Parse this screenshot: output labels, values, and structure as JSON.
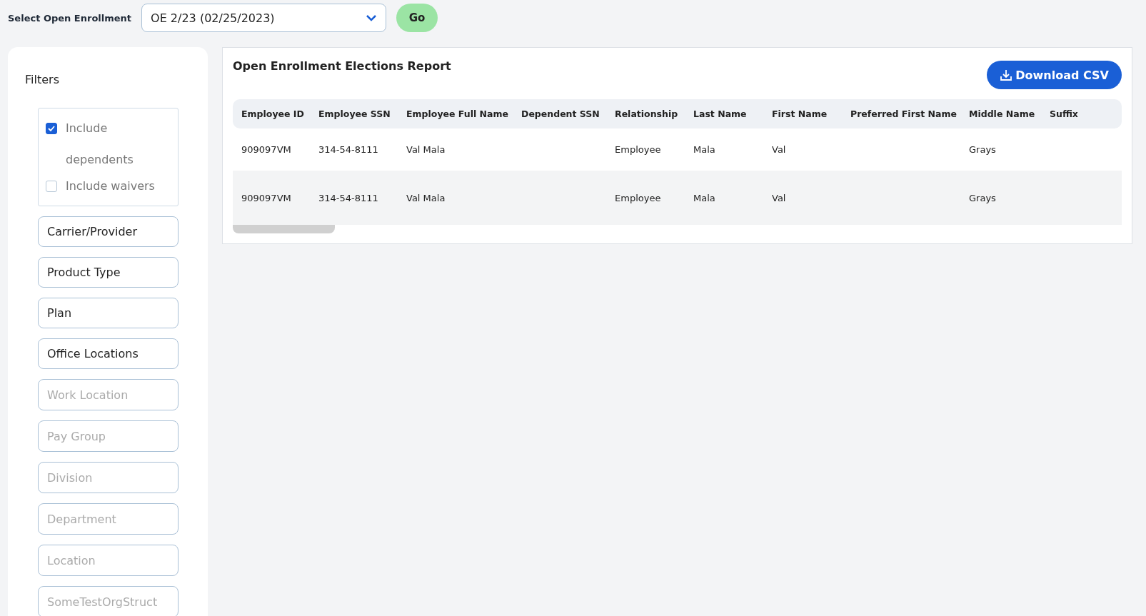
{
  "enrollment_select": {
    "label": "Select Open Enrollment",
    "value": "OE 2/23 (02/25/2023)",
    "go_button": "Go"
  },
  "filters": {
    "title": "Filters",
    "checkboxes": [
      {
        "label": "Include dependents",
        "checked": true
      },
      {
        "label": "Include waivers",
        "checked": false
      }
    ],
    "fields": [
      {
        "kind": "select",
        "label": "Carrier/Provider"
      },
      {
        "kind": "select",
        "label": "Product Type"
      },
      {
        "kind": "select",
        "label": "Plan"
      },
      {
        "kind": "select",
        "label": "Office Locations"
      },
      {
        "kind": "input",
        "placeholder": "Work Location"
      },
      {
        "kind": "input",
        "placeholder": "Pay Group"
      },
      {
        "kind": "input",
        "placeholder": "Division"
      },
      {
        "kind": "input",
        "placeholder": "Department"
      },
      {
        "kind": "input",
        "placeholder": "Location"
      },
      {
        "kind": "input",
        "placeholder": "SomeTestOrgStruct"
      }
    ]
  },
  "report": {
    "title": "Open Enrollment Elections Report",
    "download_button": "Download CSV",
    "table": {
      "columns": [
        "Employee ID",
        "Employee SSN",
        "Employee Full Name",
        "Dependent SSN",
        "Relationship",
        "Last Name",
        "First Name",
        "Preferred First Name",
        "Middle Name",
        "Suffix"
      ],
      "rows": [
        [
          "909097VM",
          "314-54-8111",
          "Val Mala",
          "",
          "Employee",
          "Mala",
          "Val",
          "",
          "Grays",
          ""
        ],
        [
          "909097VM",
          "314-54-8111",
          "Val Mala",
          "",
          "Employee",
          "Mala",
          "Val",
          "",
          "Grays",
          ""
        ]
      ]
    }
  }
}
